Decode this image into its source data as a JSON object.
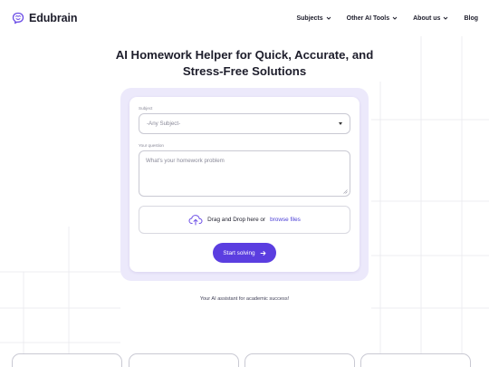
{
  "app": {
    "brand": "Edubrain",
    "logo_icon": "brain-chat-icon",
    "accent": "#5b3ee0"
  },
  "nav": {
    "items": [
      {
        "label": "Subjects",
        "has_dropdown": true
      },
      {
        "label": "Other AI Tools",
        "has_dropdown": true
      },
      {
        "label": "About us",
        "has_dropdown": true
      },
      {
        "label": "Blog",
        "has_dropdown": false
      }
    ]
  },
  "hero": {
    "title_line1": "AI Homework Helper for Quick, Accurate, and",
    "title_line2": "Stress-Free Solutions"
  },
  "form": {
    "subject_label": "Subject",
    "subject_value": "-Any Subject-",
    "question_label": "Your question",
    "question_placeholder": "What's your homework problem",
    "upload_text": "Drag and Drop here or",
    "upload_link": "browse files",
    "upload_icon": "cloud-upload-icon",
    "submit_label": "Start solving",
    "submit_icon": "arrow-right-icon"
  },
  "tagline": "Your AI assistant for academic success!"
}
